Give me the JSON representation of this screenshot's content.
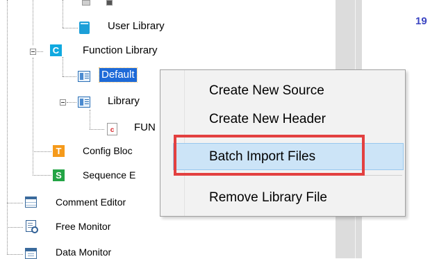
{
  "editor": {
    "line_number": "19"
  },
  "tree": {
    "user_library": "User Library",
    "function_library": "Function Library",
    "default_file": "Default",
    "library_file": "Library",
    "fun_file": "FUN",
    "config_block": "Config Bloc",
    "sequence": "Sequence E",
    "comment_editor": "Comment Editor",
    "free_monitor": "Free Monitor",
    "data_monitor": "Data Monitor",
    "icon_letters": {
      "function_library": "C",
      "config_block": "T",
      "sequence": "S",
      "c_file": "c"
    }
  },
  "context_menu": {
    "items": [
      "Create New Source",
      "Create New Header",
      "Batch Import Files",
      "Remove Library File"
    ]
  },
  "colors": {
    "selection": "#1e6ad8",
    "highlight_box": "#e34040",
    "menu_hover": "#cce4f7"
  }
}
